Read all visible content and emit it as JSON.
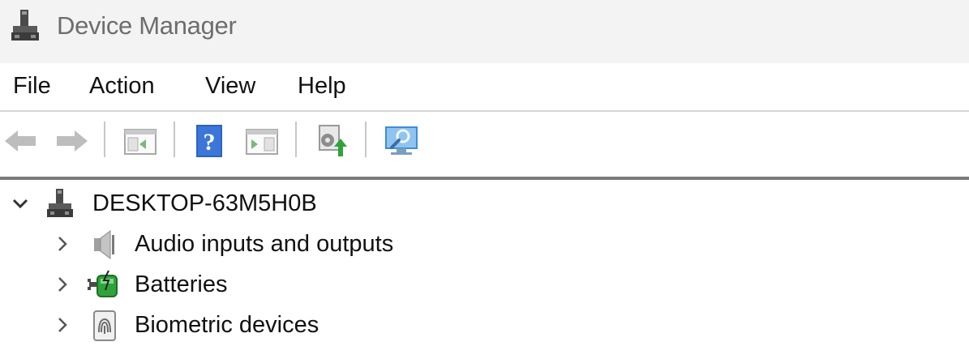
{
  "window": {
    "title": "Device Manager",
    "app_icon": "device-manager-icon"
  },
  "menu": [
    {
      "label": "File"
    },
    {
      "label": "Action"
    },
    {
      "label": "View"
    },
    {
      "label": "Help"
    }
  ],
  "toolbar": {
    "buttons": [
      {
        "icon": "back-arrow-icon",
        "enabled": false
      },
      {
        "icon": "forward-arrow-icon",
        "enabled": false
      },
      {
        "icon": "show-hide-console-tree-icon",
        "enabled": false
      },
      {
        "icon": "help-icon",
        "enabled": true
      },
      {
        "icon": "action-pane-icon",
        "enabled": false
      },
      {
        "icon": "update-driver-icon",
        "enabled": false
      },
      {
        "icon": "scan-hardware-changes-icon",
        "enabled": true
      }
    ]
  },
  "tree": {
    "root": {
      "label": "DESKTOP-63M5H0B",
      "expanded": true,
      "icon": "computer-icon"
    },
    "children": [
      {
        "label": "Audio inputs and outputs",
        "expanded": false,
        "icon": "speaker-icon"
      },
      {
        "label": "Batteries",
        "expanded": false,
        "icon": "battery-icon"
      },
      {
        "label": "Biometric devices",
        "expanded": false,
        "icon": "fingerprint-icon"
      }
    ]
  },
  "colors": {
    "titlebar_bg": "#f3f3f3",
    "title_text": "#6d6d6d",
    "help_blue": "#2b63c4",
    "accent_green": "#2fa33a"
  }
}
